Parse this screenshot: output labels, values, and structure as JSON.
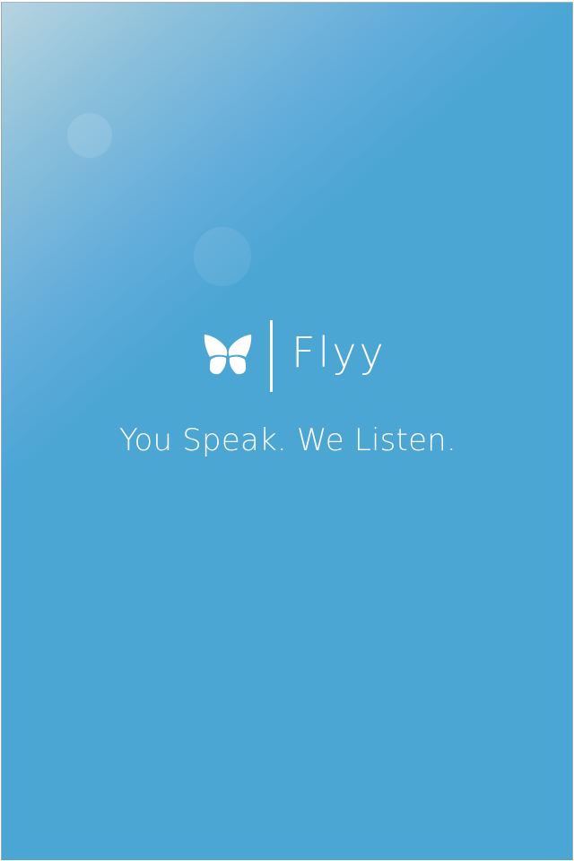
{
  "app": {
    "brand_name": "Flyy",
    "tagline": "You Speak. We Listen."
  },
  "logo": {
    "icon": "butterfly-icon"
  },
  "colors": {
    "background_main": "#4ba6d4",
    "background_light_corner": "#b6d4e0",
    "foreground": "#ffffff"
  }
}
